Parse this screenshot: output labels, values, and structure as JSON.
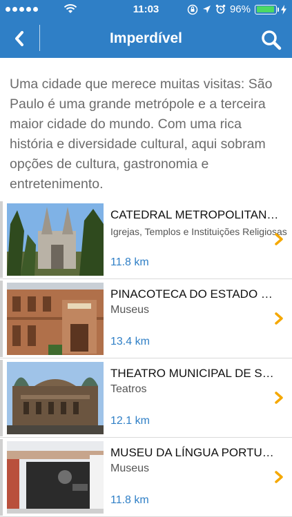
{
  "status_bar": {
    "time": "11:03",
    "battery": "96%"
  },
  "nav": {
    "title": "Imperdível",
    "back_icon": "chevron-left-icon",
    "search_icon": "search-icon"
  },
  "intro_text": "Uma cidade que merece muitas visitas: São Paulo é uma grande metrópole e a terceira maior cidade do mundo. Com uma rica história e diversidade cultural, aqui sobram opções de cultura, gastronomia e entretenimento.",
  "colors": {
    "nav_bar": "#2f7fc6",
    "distance": "#2f7fc6",
    "chevron": "#f5a800"
  },
  "places": [
    {
      "title": "CATEDRAL METROPOLITANA DA SÉ",
      "category": "Igrejas, Templos e Instituições Religiosas",
      "distance": "11.8 km"
    },
    {
      "title": "PINACOTECA DO ESTADO DE SÃO PAULO",
      "category": "Museus",
      "distance": "13.4 km"
    },
    {
      "title": "THEATRO MUNICIPAL DE SÃO PAULO",
      "category": "Teatros",
      "distance": "12.1 km"
    },
    {
      "title": "MUSEU DA LÍNGUA PORTUGUESA",
      "category": "Museus",
      "distance": "11.8 km"
    }
  ]
}
